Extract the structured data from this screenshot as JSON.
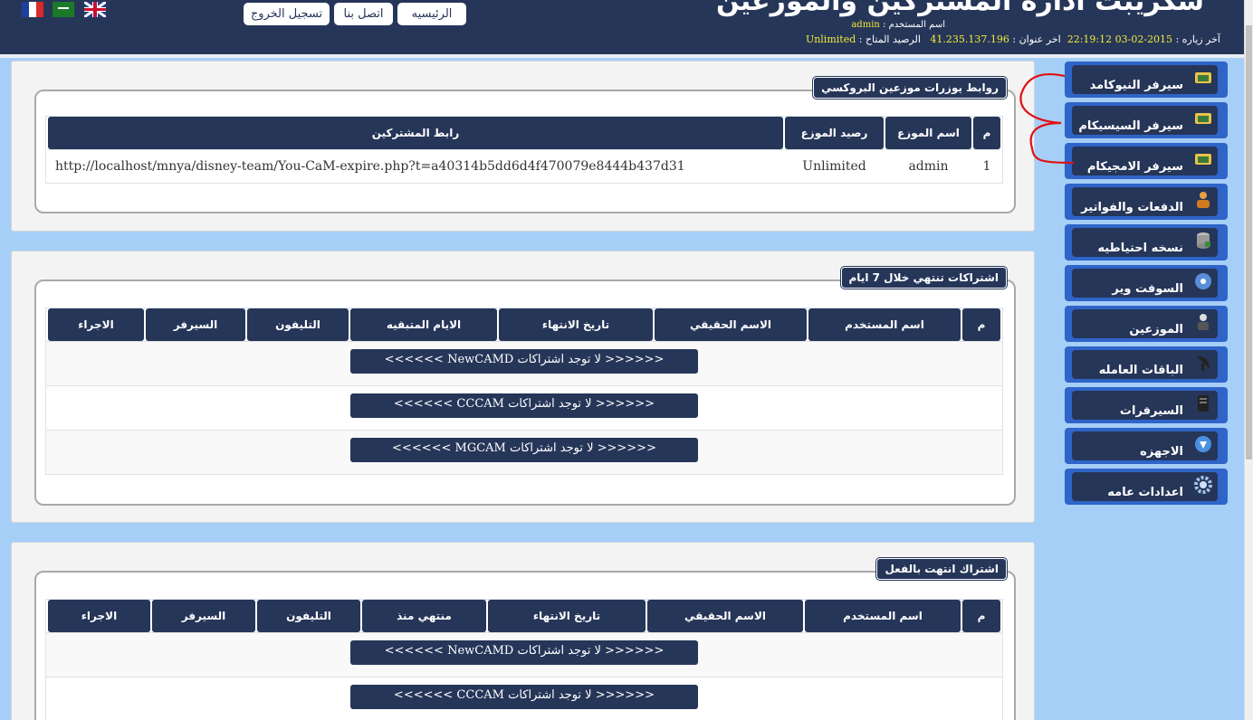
{
  "header": {
    "title": "سكريبت ادارة المشتركين والموزعين",
    "user_label": "اسم المستخدم :",
    "user_value": "admin",
    "last_visit_label": "آخر زياره :",
    "last_visit_value": "2015-02-03 22:19:12",
    "ip_label": "اخر عنوان :",
    "ip_value": "41.235.137.196",
    "balance_label": "الرصيد المتاح :",
    "balance_value": "Unlimited",
    "buttons": {
      "home": "الرئيسيه",
      "contact": "اتصل بنا",
      "logout": "تسجيل الخروج"
    }
  },
  "panel1": {
    "legend": "روابط يوزرات موزعين البروكسي",
    "columns": [
      "م",
      "اسم الموزع",
      "رصيد الموزع",
      "رابط المشتركين"
    ],
    "rows": [
      [
        "1",
        "admin",
        "Unlimited",
        "http://localhost/mnya/disney-team/You-CaM-expire.php?t=a40314b5dd6d4f470079e8444b437d31"
      ]
    ]
  },
  "panel2": {
    "legend": "اشتراكات تنتهي خلال 7 ايام",
    "columns": [
      "م",
      "اسم المستخدم",
      "الاسم الحقيقي",
      "تاريخ الانتهاء",
      "الايام المتبقيه",
      "التليفون",
      "السيرفر",
      "الاجراء"
    ],
    "messages": [
      "<<<<<< لا توجد اشتراكات NewCAMD >>>>>>",
      "<<<<<< لا توجد اشتراكات CCCAM >>>>>>",
      "<<<<<< لا توجد اشتراكات MGCAM >>>>>>"
    ]
  },
  "panel3": {
    "legend": "اشتراك انتهت بالفعل",
    "columns": [
      "م",
      "اسم المستخدم",
      "الاسم الحقيقي",
      "تاريخ الانتهاء",
      "منتهي منذ",
      "التليفون",
      "السيرفر",
      "الاجراء"
    ],
    "messages": [
      "<<<<<< لا توجد اشتراكات NewCAMD >>>>>>",
      "<<<<<< لا توجد اشتراكات CCCAM >>>>>>"
    ]
  },
  "sidebar": {
    "items": [
      {
        "label": "سيرفر النيوكامد",
        "icon": "monitor-icon"
      },
      {
        "label": "سيرفر السيسيكام",
        "icon": "monitor-icon"
      },
      {
        "label": "سيرفر الامجيكام",
        "icon": "monitor-icon"
      },
      {
        "label": "الدفعات والفواتير",
        "icon": "people-icon"
      },
      {
        "label": "نسخه احتياطيه",
        "icon": "database-icon"
      },
      {
        "label": "السوفت وير",
        "icon": "disc-icon"
      },
      {
        "label": "الموزعين",
        "icon": "user-icon"
      },
      {
        "label": "الباقات العامله",
        "icon": "satellite-icon"
      },
      {
        "label": "السيرفرات",
        "icon": "server-icon"
      },
      {
        "label": "الاجهزه",
        "icon": "globe-icon"
      },
      {
        "label": "اعدادات عامه",
        "icon": "gear-icon"
      }
    ]
  }
}
